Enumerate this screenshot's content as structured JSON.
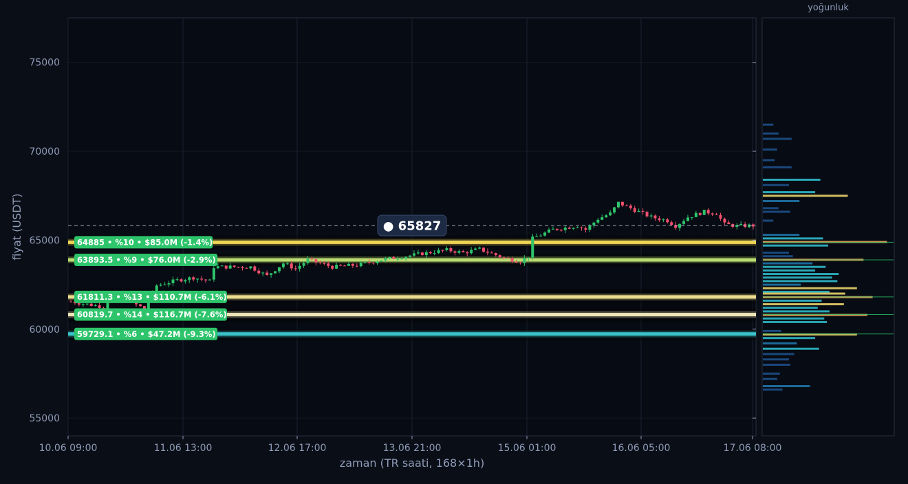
{
  "chart_data": {
    "type": "candlestick",
    "title": "",
    "xlabel": "zaman (TR saati, 168×1h)",
    "ylabel": "fiyat (USDT)",
    "ylim": [
      54000,
      77500
    ],
    "yticks": [
      55000,
      60000,
      65000,
      70000,
      75000
    ],
    "xticks": [
      "10.06 09:00",
      "11.06 13:00",
      "12.06 17:00",
      "13.06 21:00",
      "15.06 01:00",
      "16.06 05:00",
      "17.06 08:00"
    ],
    "grid": true,
    "candle_count": 168,
    "close_path": [
      {
        "i": 0,
        "price": 61550
      },
      {
        "i": 8,
        "price": 61250
      },
      {
        "i": 10,
        "price": 62050
      },
      {
        "i": 14,
        "price": 61600
      },
      {
        "i": 18,
        "price": 61150
      },
      {
        "i": 21,
        "price": 62450
      },
      {
        "i": 26,
        "price": 62750
      },
      {
        "i": 30,
        "price": 62900
      },
      {
        "i": 34,
        "price": 62700
      },
      {
        "i": 35,
        "price": 63500
      },
      {
        "i": 44,
        "price": 63500
      },
      {
        "i": 48,
        "price": 63000
      },
      {
        "i": 52,
        "price": 63700
      },
      {
        "i": 55,
        "price": 63400
      },
      {
        "i": 58,
        "price": 63900
      },
      {
        "i": 64,
        "price": 63500
      },
      {
        "i": 70,
        "price": 63600
      },
      {
        "i": 76,
        "price": 63900
      },
      {
        "i": 82,
        "price": 64100
      },
      {
        "i": 86,
        "price": 64250
      },
      {
        "i": 92,
        "price": 64450
      },
      {
        "i": 96,
        "price": 64300
      },
      {
        "i": 100,
        "price": 64500
      },
      {
        "i": 106,
        "price": 64000
      },
      {
        "i": 110,
        "price": 63800
      },
      {
        "i": 112,
        "price": 64100
      },
      {
        "i": 113,
        "price": 65100
      },
      {
        "i": 118,
        "price": 65600
      },
      {
        "i": 124,
        "price": 65800
      },
      {
        "i": 126,
        "price": 65600
      },
      {
        "i": 129,
        "price": 66200
      },
      {
        "i": 132,
        "price": 66500
      },
      {
        "i": 134,
        "price": 67100
      },
      {
        "i": 138,
        "price": 66700
      },
      {
        "i": 142,
        "price": 66300
      },
      {
        "i": 146,
        "price": 66100
      },
      {
        "i": 148,
        "price": 65800
      },
      {
        "i": 151,
        "price": 66300
      },
      {
        "i": 155,
        "price": 66600
      },
      {
        "i": 158,
        "price": 66500
      },
      {
        "i": 160,
        "price": 65900
      },
      {
        "i": 163,
        "price": 65800
      },
      {
        "i": 167,
        "price": 65827
      }
    ],
    "current_price": 65827,
    "current_price_label": "● 65827",
    "levels": [
      {
        "price": 64885,
        "label": "64885 • %10 • $85.0M (-1.4%)",
        "color": "#ffe45c"
      },
      {
        "price": 63893.5,
        "label": "63893.5 • %9 • $76.0M (-2.9%)",
        "color": "#c9ec7a"
      },
      {
        "price": 61811.3,
        "label": "61811.3 • %13 • $110.7M (-6.1%)",
        "color": "#fff09a"
      },
      {
        "price": 60819.7,
        "label": "60819.7 • %14 • $116.7M (-7.6%)",
        "color": "#fff6c4"
      },
      {
        "price": 59729.1,
        "label": "59729.1 • %6 • $47.2M (-9.3%)",
        "color": "#3fd2d8"
      }
    ],
    "level_label_color": "#2ec46b",
    "up_color": "#2ec46b",
    "down_color": "#f0506e",
    "density_panel_title": "yoğunluk",
    "density_profile": [
      {
        "price": 71500,
        "value": 0.08
      },
      {
        "price": 71000,
        "value": 0.12
      },
      {
        "price": 70700,
        "value": 0.22
      },
      {
        "price": 70100,
        "value": 0.11
      },
      {
        "price": 69500,
        "value": 0.09
      },
      {
        "price": 69100,
        "value": 0.22
      },
      {
        "price": 68400,
        "value": 0.44
      },
      {
        "price": 68100,
        "value": 0.2
      },
      {
        "price": 67700,
        "value": 0.4
      },
      {
        "price": 67500,
        "value": 0.65
      },
      {
        "price": 67200,
        "value": 0.28
      },
      {
        "price": 66800,
        "value": 0.12
      },
      {
        "price": 66600,
        "value": 0.21
      },
      {
        "price": 66100,
        "value": 0.08
      },
      {
        "price": 65300,
        "value": 0.28
      },
      {
        "price": 65100,
        "value": 0.46
      },
      {
        "price": 64900,
        "value": 0.95
      },
      {
        "price": 64700,
        "value": 0.5
      },
      {
        "price": 64300,
        "value": 0.2
      },
      {
        "price": 64100,
        "value": 0.23
      },
      {
        "price": 63900,
        "value": 0.77
      },
      {
        "price": 63700,
        "value": 0.38
      },
      {
        "price": 63500,
        "value": 0.48
      },
      {
        "price": 63300,
        "value": 0.4
      },
      {
        "price": 63100,
        "value": 0.58
      },
      {
        "price": 62900,
        "value": 0.53
      },
      {
        "price": 62700,
        "value": 0.57
      },
      {
        "price": 62500,
        "value": 0.29
      },
      {
        "price": 62300,
        "value": 0.72
      },
      {
        "price": 62100,
        "value": 0.51
      },
      {
        "price": 62000,
        "value": 0.63
      },
      {
        "price": 61800,
        "value": 0.84
      },
      {
        "price": 61600,
        "value": 0.45
      },
      {
        "price": 61400,
        "value": 0.62
      },
      {
        "price": 61200,
        "value": 0.42
      },
      {
        "price": 61000,
        "value": 0.51
      },
      {
        "price": 60800,
        "value": 0.8
      },
      {
        "price": 60600,
        "value": 0.47
      },
      {
        "price": 60400,
        "value": 0.49
      },
      {
        "price": 59900,
        "value": 0.14
      },
      {
        "price": 59700,
        "value": 0.72
      },
      {
        "price": 59500,
        "value": 0.4
      },
      {
        "price": 59200,
        "value": 0.26
      },
      {
        "price": 58900,
        "value": 0.43
      },
      {
        "price": 58600,
        "value": 0.24
      },
      {
        "price": 58300,
        "value": 0.2
      },
      {
        "price": 58000,
        "value": 0.21
      },
      {
        "price": 57500,
        "value": 0.13
      },
      {
        "price": 57200,
        "value": 0.11
      },
      {
        "price": 56800,
        "value": 0.36
      },
      {
        "price": 56600,
        "value": 0.15
      }
    ]
  }
}
